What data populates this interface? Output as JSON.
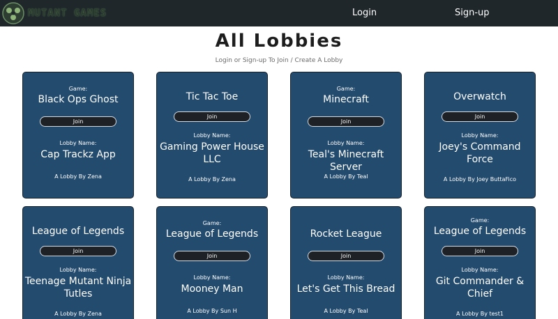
{
  "nav": {
    "brand": "MUTANT GAMES",
    "login": "Login",
    "signup": "Sign-up"
  },
  "header": {
    "title": "All Lobbies",
    "subtitle": "Login or Sign-up To Join / Create A Lobby"
  },
  "common": {
    "game_label": "Game:",
    "lobby_label": "Lobby Name:",
    "join_label": "Join"
  },
  "lobbies": [
    {
      "game": "Black Ops Ghost",
      "lobby_name": "Cap Trackz App",
      "byline": "A Lobby By Zena"
    },
    {
      "game": "Tic Tac Toe",
      "lobby_name": "Gaming Power House LLC",
      "byline": "A Lobby By Zena"
    },
    {
      "game": "Minecraft",
      "lobby_name": "Teal's Minecraft Server",
      "byline": "A Lobby By Teal"
    },
    {
      "game": "Overwatch",
      "lobby_name": "Joey's Command Force",
      "byline": "A Lobby By Joey ButtaFico"
    },
    {
      "game": "League of Legends",
      "lobby_name": "Teenage Mutant Ninja Tutles",
      "byline": "A Lobby By Zena"
    },
    {
      "game": "League of Legends",
      "lobby_name": "Mooney Man",
      "byline": "A Lobby By Sun H"
    },
    {
      "game": "Rocket League",
      "lobby_name": "Let's Get This Bread",
      "byline": "A Lobby By Teal"
    },
    {
      "game": "League of Legends",
      "lobby_name": "Git Commander & Chief",
      "byline": "A Lobby By test1"
    }
  ]
}
